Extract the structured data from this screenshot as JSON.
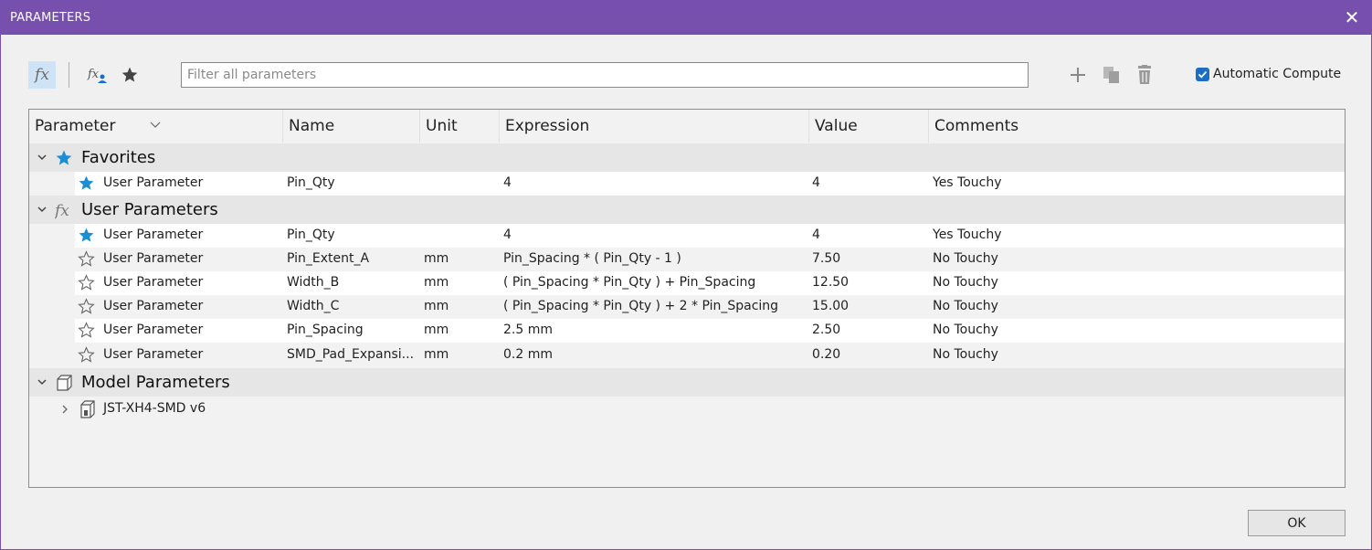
{
  "window": {
    "title": "PARAMETERS",
    "close_glyph": "✕"
  },
  "toolbar": {
    "fx_icon": "fx-icon",
    "user_fx_icon": "user-parameter-icon",
    "favorite_icon": "star-icon",
    "filter_placeholder": "Filter all parameters",
    "filter_value": "",
    "add_icon": "plus-icon",
    "copy_icon": "copy-icon",
    "delete_icon": "trash-icon",
    "auto_compute_label": "Automatic Compute",
    "auto_compute_checked": true
  },
  "table": {
    "columns": [
      "Parameter",
      "Name",
      "Unit",
      "Expression",
      "Value",
      "Comments"
    ],
    "groups": {
      "favorites": {
        "title": "Favorites",
        "rows": [
          {
            "param": "User Parameter",
            "name": "Pin_Qty",
            "unit": "",
            "expr": "4",
            "value": "4",
            "comment": "Yes Touchy",
            "favorite": true
          }
        ]
      },
      "user": {
        "title": "User Parameters",
        "rows": [
          {
            "param": "User Parameter",
            "name": "Pin_Qty",
            "unit": "",
            "expr": "4",
            "value": "4",
            "comment": "Yes Touchy",
            "favorite": true
          },
          {
            "param": "User Parameter",
            "name": "Pin_Extent_A",
            "unit": "mm",
            "expr": "Pin_Spacing * ( Pin_Qty - 1 )",
            "value": "7.50",
            "comment": "No Touchy",
            "favorite": false
          },
          {
            "param": "User Parameter",
            "name": "Width_B",
            "unit": "mm",
            "expr": "( Pin_Spacing * Pin_Qty ) + Pin_Spacing",
            "value": "12.50",
            "comment": "No Touchy",
            "favorite": false
          },
          {
            "param": "User Parameter",
            "name": "Width_C",
            "unit": "mm",
            "expr": "( Pin_Spacing * Pin_Qty ) + 2 * Pin_Spacing",
            "value": "15.00",
            "comment": "No Touchy",
            "favorite": false
          },
          {
            "param": "User Parameter",
            "name": "Pin_Spacing",
            "unit": "mm",
            "expr": "2.5 mm",
            "value": "2.50",
            "comment": "No Touchy",
            "favorite": false
          },
          {
            "param": "User Parameter",
            "name": "SMD_Pad_Expansi...",
            "unit": "mm",
            "expr": "0.2 mm",
            "value": "0.20",
            "comment": "No Touchy",
            "favorite": false
          }
        ]
      },
      "model": {
        "title": "Model Parameters",
        "component": "JST-XH4-SMD v6"
      }
    }
  },
  "footer": {
    "ok_label": "OK"
  },
  "colors": {
    "titlebar": "#7650ac",
    "star_active": "#1a8fd6",
    "accent": "#1a6fc4"
  }
}
